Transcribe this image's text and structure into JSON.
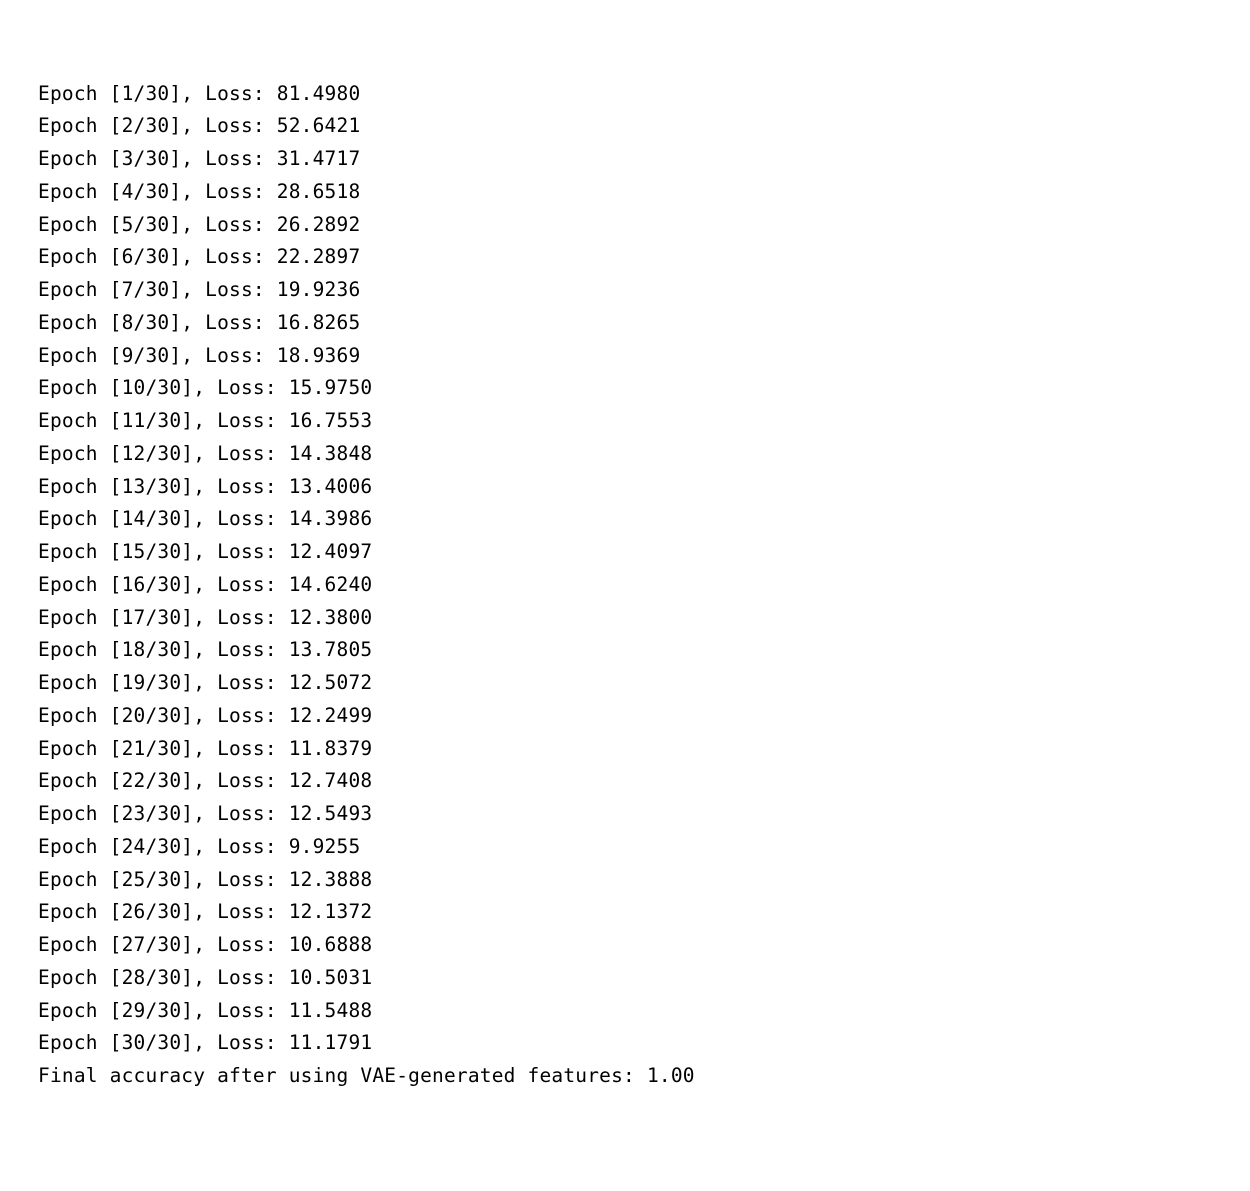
{
  "training": {
    "total_epochs": 30,
    "epochs": [
      {
        "n": 1,
        "loss": "81.4980"
      },
      {
        "n": 2,
        "loss": "52.6421"
      },
      {
        "n": 3,
        "loss": "31.4717"
      },
      {
        "n": 4,
        "loss": "28.6518"
      },
      {
        "n": 5,
        "loss": "26.2892"
      },
      {
        "n": 6,
        "loss": "22.2897"
      },
      {
        "n": 7,
        "loss": "19.9236"
      },
      {
        "n": 8,
        "loss": "16.8265"
      },
      {
        "n": 9,
        "loss": "18.9369"
      },
      {
        "n": 10,
        "loss": "15.9750"
      },
      {
        "n": 11,
        "loss": "16.7553"
      },
      {
        "n": 12,
        "loss": "14.3848"
      },
      {
        "n": 13,
        "loss": "13.4006"
      },
      {
        "n": 14,
        "loss": "14.3986"
      },
      {
        "n": 15,
        "loss": "12.4097"
      },
      {
        "n": 16,
        "loss": "14.6240"
      },
      {
        "n": 17,
        "loss": "12.3800"
      },
      {
        "n": 18,
        "loss": "13.7805"
      },
      {
        "n": 19,
        "loss": "12.5072"
      },
      {
        "n": 20,
        "loss": "12.2499"
      },
      {
        "n": 21,
        "loss": "11.8379"
      },
      {
        "n": 22,
        "loss": "12.7408"
      },
      {
        "n": 23,
        "loss": "12.5493"
      },
      {
        "n": 24,
        "loss": "9.9255"
      },
      {
        "n": 25,
        "loss": "12.3888"
      },
      {
        "n": 26,
        "loss": "12.1372"
      },
      {
        "n": 27,
        "loss": "10.6888"
      },
      {
        "n": 28,
        "loss": "10.5031"
      },
      {
        "n": 29,
        "loss": "11.5488"
      },
      {
        "n": 30,
        "loss": "11.1791"
      }
    ]
  },
  "summary": {
    "label": "Final accuracy after using VAE-generated features:",
    "value": "1.00"
  }
}
